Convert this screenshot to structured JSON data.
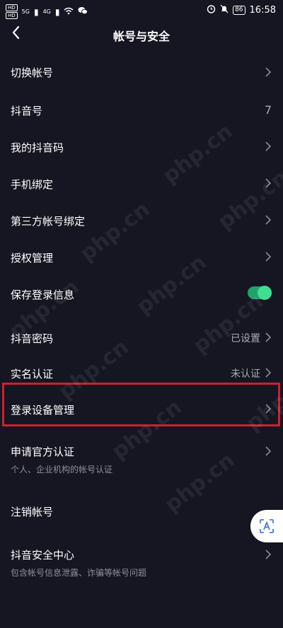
{
  "status_bar": {
    "hd1": "HD",
    "hd2": "HD",
    "net1": "5G",
    "net2": "4G",
    "battery": "86",
    "time": "16:58"
  },
  "header": {
    "title": "帐号与安全"
  },
  "items": [
    {
      "label": "切换帐号"
    },
    {
      "label": "抖音号",
      "value": "7"
    },
    {
      "label": "我的抖音码"
    },
    {
      "label": "手机绑定"
    },
    {
      "label": "第三方帐号绑定"
    },
    {
      "label": "授权管理"
    },
    {
      "label": "保存登录信息",
      "toggle_on": true
    },
    {
      "label": "抖音密码",
      "value": "已设置"
    },
    {
      "label": "实名认证",
      "value": "未认证"
    },
    {
      "label": "登录设备管理"
    },
    {
      "label": "申请官方认证",
      "sub": "个人、企业机构的帐号认证"
    },
    {
      "label": "注销帐号"
    },
    {
      "label": "抖音安全中心",
      "sub": "包含帐号信息泄露、诈骗等帐号问题"
    }
  ],
  "watermark": "php.cn",
  "colors": {
    "background": "#161622",
    "toggle": "#3ee090",
    "highlight": "#d0202a"
  }
}
